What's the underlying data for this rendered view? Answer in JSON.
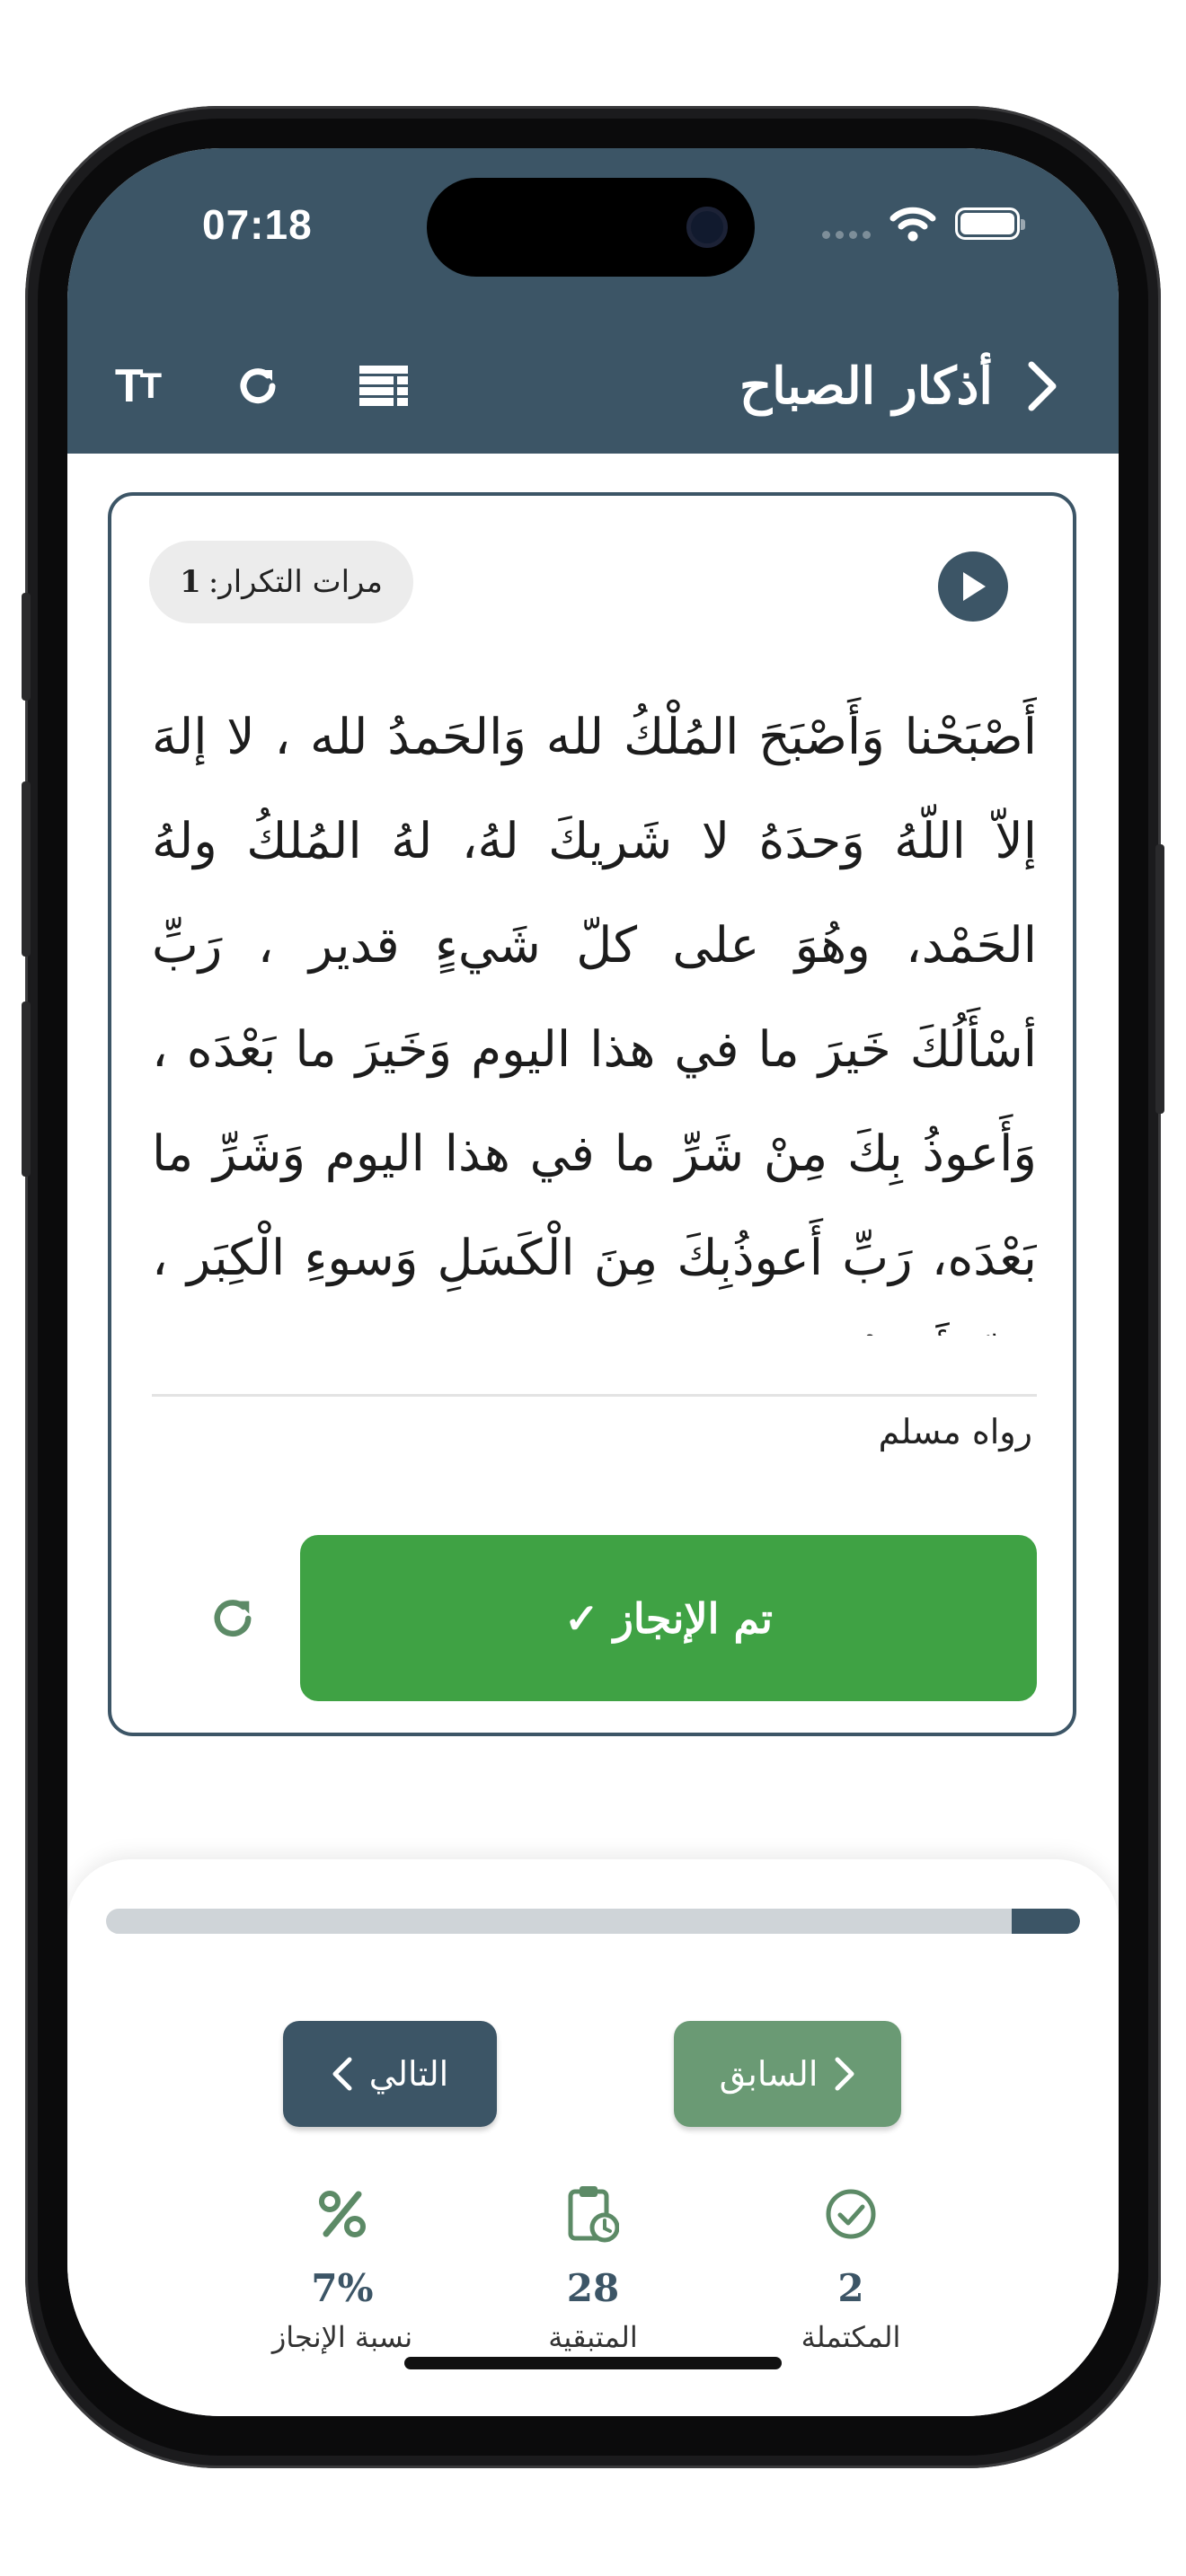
{
  "status_bar": {
    "time": "07:18"
  },
  "header": {
    "title": "أذكار الصباح",
    "font_size_icon": "text-size-icon",
    "reset_icon": "reload-icon",
    "list_icon": "list-icon",
    "back_icon": "chevron-right-icon"
  },
  "zikr": {
    "repeat_label": "مرات التكرار:",
    "repeat_count": "1",
    "text": "أَصْبَحْنا وَأَصْبَحَ المُلْكُ لله وَالحَمدُ لله ، لا إلهَ إلاّ اللّهُ وَحدَهُ لا شَريكَ لهُ، لهُ المُلكُ ولهُ الحَمْد، وهُوَ على كلّ شَيءٍ قدير ، رَبِّ أسْأَلُكَ خَيرَ ما في هذا اليوم وَخَيرَ ما بَعْدَه ، وَأَعوذُ بِكَ مِنْ شَرِّ ما في هذا اليوم وَشَرِّ ما بَعْدَه، رَبِّ أَعوذُبِكَ مِنَ الْكَسَلِ وَسوءِ الْكِبَر ، رَبِّ أَعوذُ بِكَ مِنْ عَذابٍ في النّارِ وَعَذابٍ في القَبْر.",
    "source": "رواه مسلم",
    "done_label": "تم الإنجاز ✓"
  },
  "progress": {
    "fraction": 0.07
  },
  "navigation": {
    "next_label": "التالي",
    "prev_label": "السابق"
  },
  "stats": {
    "percent": {
      "value": "7%",
      "label": "نسبة الإنجاز",
      "icon": "percent-icon"
    },
    "remaining": {
      "value": "28",
      "label": "المتبقية",
      "icon": "clipboard-clock-icon"
    },
    "completed": {
      "value": "2",
      "label": "المكتملة",
      "icon": "check-circle-icon"
    }
  },
  "colors": {
    "primary": "#3c5566",
    "success": "#3fa244",
    "muted_green": "#6a9a74",
    "icon_green": "#5c8a66"
  }
}
